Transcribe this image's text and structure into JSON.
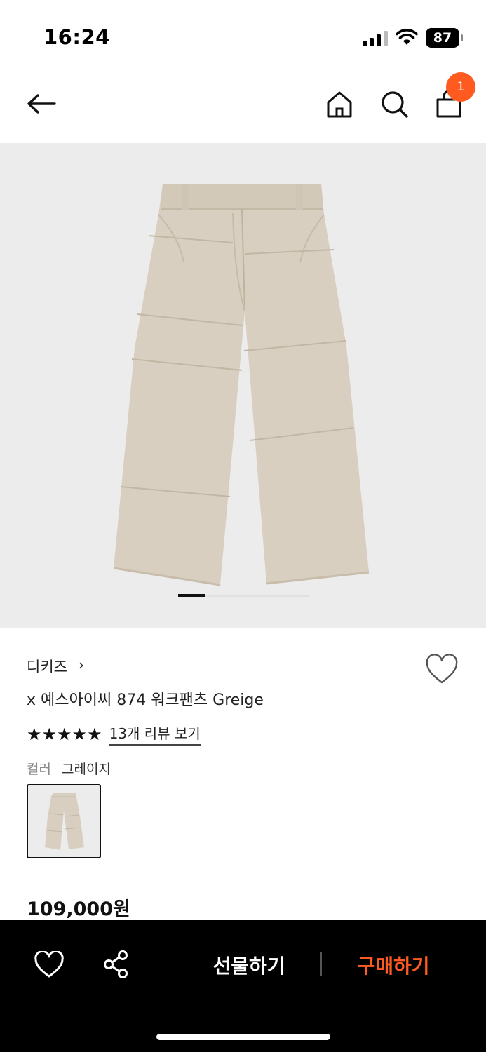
{
  "status_bar": {
    "time": "16:24",
    "battery": "87"
  },
  "header": {
    "cart_count": "1",
    "icons": [
      "back-arrow-icon",
      "home-icon",
      "search-icon",
      "shopping-bag-icon"
    ]
  },
  "image_carousel": {
    "current": 1
  },
  "product": {
    "brand": "디키즈",
    "brand_chevron": "›",
    "name": "x 예스아이씨 874 워크팬츠 Greige",
    "stars": "★★★★★",
    "rating": 5,
    "review_link": "13개 리뷰 보기",
    "color_label": "컬러",
    "color_value": "그레이지",
    "price": "109,000원"
  },
  "bottom_bar": {
    "gift_label": "선물하기",
    "buy_label": "구매하기",
    "icons": [
      "heart-icon",
      "share-icon"
    ]
  },
  "colors": {
    "accent": "#ff5a1f",
    "image_bg": "#ececec",
    "pants": "#d8cfc0",
    "bar_bg": "#000000"
  }
}
